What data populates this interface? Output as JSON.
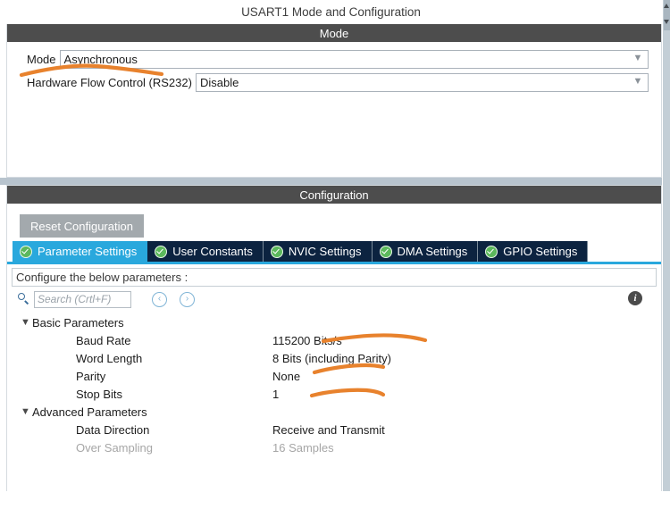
{
  "window": {
    "title": "USART1 Mode and Configuration"
  },
  "mode_panel": {
    "band_label": "Mode",
    "fields": [
      {
        "label": "Mode",
        "value": "Asynchronous",
        "chevron_icon": "chevron-down-icon"
      },
      {
        "label": "Hardware Flow Control (RS232)",
        "value": "Disable",
        "chevron_icon": "chevron-down-icon"
      }
    ]
  },
  "config_panel": {
    "band_label": "Configuration",
    "reset_button_label": "Reset Configuration",
    "tabs": [
      {
        "label": "Parameter Settings",
        "active": true,
        "icon": "check-circle-icon"
      },
      {
        "label": "User Constants",
        "active": false,
        "icon": "check-circle-icon"
      },
      {
        "label": "NVIC Settings",
        "active": false,
        "icon": "check-circle-icon"
      },
      {
        "label": "DMA Settings",
        "active": false,
        "icon": "check-circle-icon"
      },
      {
        "label": "GPIO Settings",
        "active": false,
        "icon": "check-circle-icon"
      }
    ],
    "configure_hint": "Configure the below parameters :",
    "search": {
      "placeholder": "Search (Crtl+F)",
      "icon": "search-icon",
      "prev_label": "‹",
      "next_label": "›"
    },
    "info_icon_label": "i",
    "groups": [
      {
        "name": "Basic Parameters",
        "twisty": "chevron-down-icon",
        "rows": [
          {
            "name": "Baud Rate",
            "value": "115200 Bits/s",
            "disabled": false
          },
          {
            "name": "Word Length",
            "value": "8 Bits (including Parity)",
            "disabled": false
          },
          {
            "name": "Parity",
            "value": "None",
            "disabled": false
          },
          {
            "name": "Stop Bits",
            "value": "1",
            "disabled": false
          }
        ]
      },
      {
        "name": "Advanced Parameters",
        "twisty": "chevron-down-icon",
        "rows": [
          {
            "name": "Data Direction",
            "value": "Receive and Transmit",
            "disabled": false
          },
          {
            "name": "Over Sampling",
            "value": "16 Samples",
            "disabled": true
          }
        ]
      }
    ]
  },
  "colors": {
    "band": "#4d4d4d",
    "active_tab": "#29a8dd",
    "inactive_tab": "#0c2340",
    "check_green": "#5cb85c",
    "annotation_orange": "#e8822d",
    "reset_button": "#a3a9ad",
    "panel_gap": "#b8c4ce"
  },
  "annotations": {
    "color": "#e8822d",
    "description": "hand-drawn orange underline strokes"
  }
}
